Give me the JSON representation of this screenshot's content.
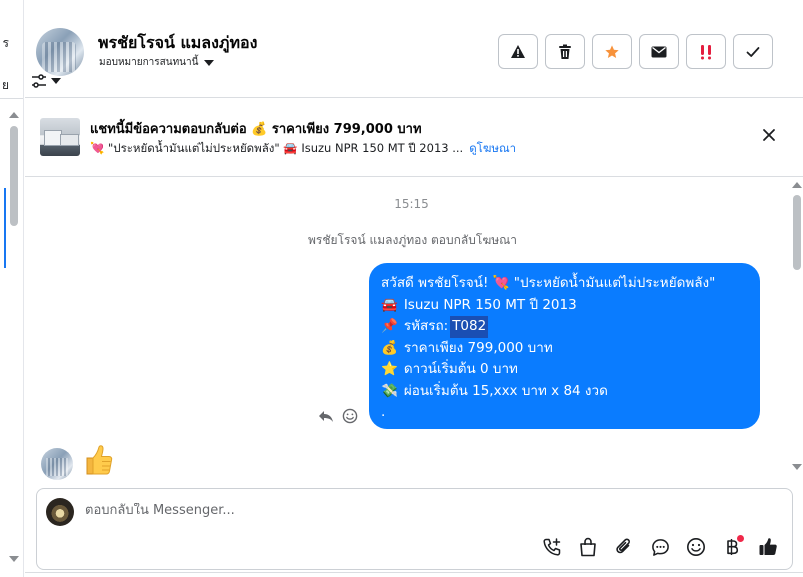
{
  "left_strip": {
    "fragment_top": "ร",
    "fragment_mid": "ย"
  },
  "header": {
    "contact_name": "พรชัยโรจน์ แมลงภู่ทอง",
    "assign_label": "มอบหมายการสนทนานี้",
    "actions": [
      {
        "icon": "warning-icon"
      },
      {
        "icon": "trash-icon"
      },
      {
        "icon": "star-icon",
        "color": "#f7923b"
      },
      {
        "icon": "envelope-icon"
      },
      {
        "icon": "double-exclamation-icon",
        "color": "#e41e3f"
      },
      {
        "icon": "check-icon"
      }
    ]
  },
  "ad_banner": {
    "title_prefix": "แชทนี้มีข้อความตอบกลับต่อ",
    "title_emoji": "💰",
    "title_suffix": "ราคาเพียง 799,000 บาท",
    "subtitle": "💘 \"ประหยัดน้ำมันแต่ไม่ประหยัดพลัง\" 🚘 Isuzu NPR 150 MT ปี 2013 ...",
    "link_label": "ดูโฆษณา"
  },
  "chat": {
    "time": "15:15",
    "reply_note": "พรชัยโรจน์ แมลงภู่ทอง ตอบกลับโฆษณา",
    "message_lines": [
      {
        "text": "สวัสดี พรชัยโรจน์! 💘 \"ประหยัดน้ำมันแต่ไม่ประหยัดพลัง\""
      },
      {
        "emoji": "🚘",
        "text": "Isuzu NPR 150 MT ปี 2013"
      },
      {
        "emoji": "📌",
        "text": "รหัสรถ:",
        "highlight": "T082"
      },
      {
        "emoji": "💰",
        "text": "ราคาเพียง 799,000 บาท"
      },
      {
        "emoji": "⭐",
        "text": "ดาวน์เริ่มต้น 0 บาท"
      },
      {
        "emoji": "💸",
        "text": "ผ่อนเริ่มต้น 15,xxx บาท x 84 งวด"
      },
      {
        "text": "."
      }
    ],
    "incoming_reaction": "thumbs-up",
    "bubble_color": "#0a7cff"
  },
  "composer": {
    "placeholder": "ตอบกลับใน Messenger...",
    "tools": [
      "call-plus-icon",
      "shopping-bag-icon",
      "paperclip-icon",
      "chat-bubble-icon",
      "smiley-icon",
      "baht-icon",
      "thumbs-up-icon"
    ]
  }
}
